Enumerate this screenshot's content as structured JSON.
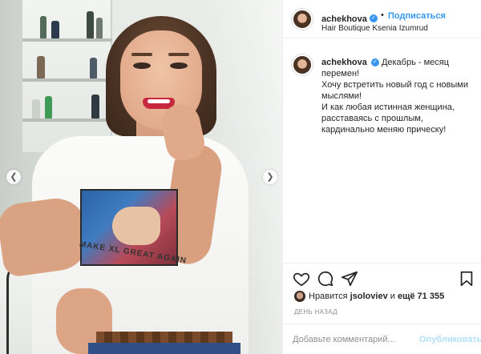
{
  "post": {
    "username": "achekhova",
    "follow_label": "Подписаться",
    "separator": "•",
    "location": "Hair Boutique Ksenia Izumrud",
    "caption": "Декабрь - месяц перемен!\nХочу встретить новый год с новыми мыслями!\nИ как любая истинная женщина, расставаясь с прошлым, кардинально меняю прическу!",
    "shirt_print_text": "MAKE XL GREAT AGAIN"
  },
  "carousel": {
    "prev_icon": "chevron-left-icon",
    "next_icon": "chevron-right-icon"
  },
  "actions": {
    "icons": [
      "heart-icon",
      "comment-icon",
      "share-icon",
      "bookmark-icon"
    ],
    "likes_prefix": "Нравится",
    "likes_user": "jsoloviev",
    "likes_joiner": "и",
    "likes_more": "ещё 71 355",
    "time_ago": "ДЕНЬ НАЗАД"
  },
  "comment": {
    "placeholder": "Добавьте комментарий...",
    "publish_label": "Опубликовать"
  },
  "colors": {
    "accent": "#3897f0",
    "publish_disabled": "#b2dffc",
    "text": "#262626",
    "muted": "#8e8e8e"
  }
}
